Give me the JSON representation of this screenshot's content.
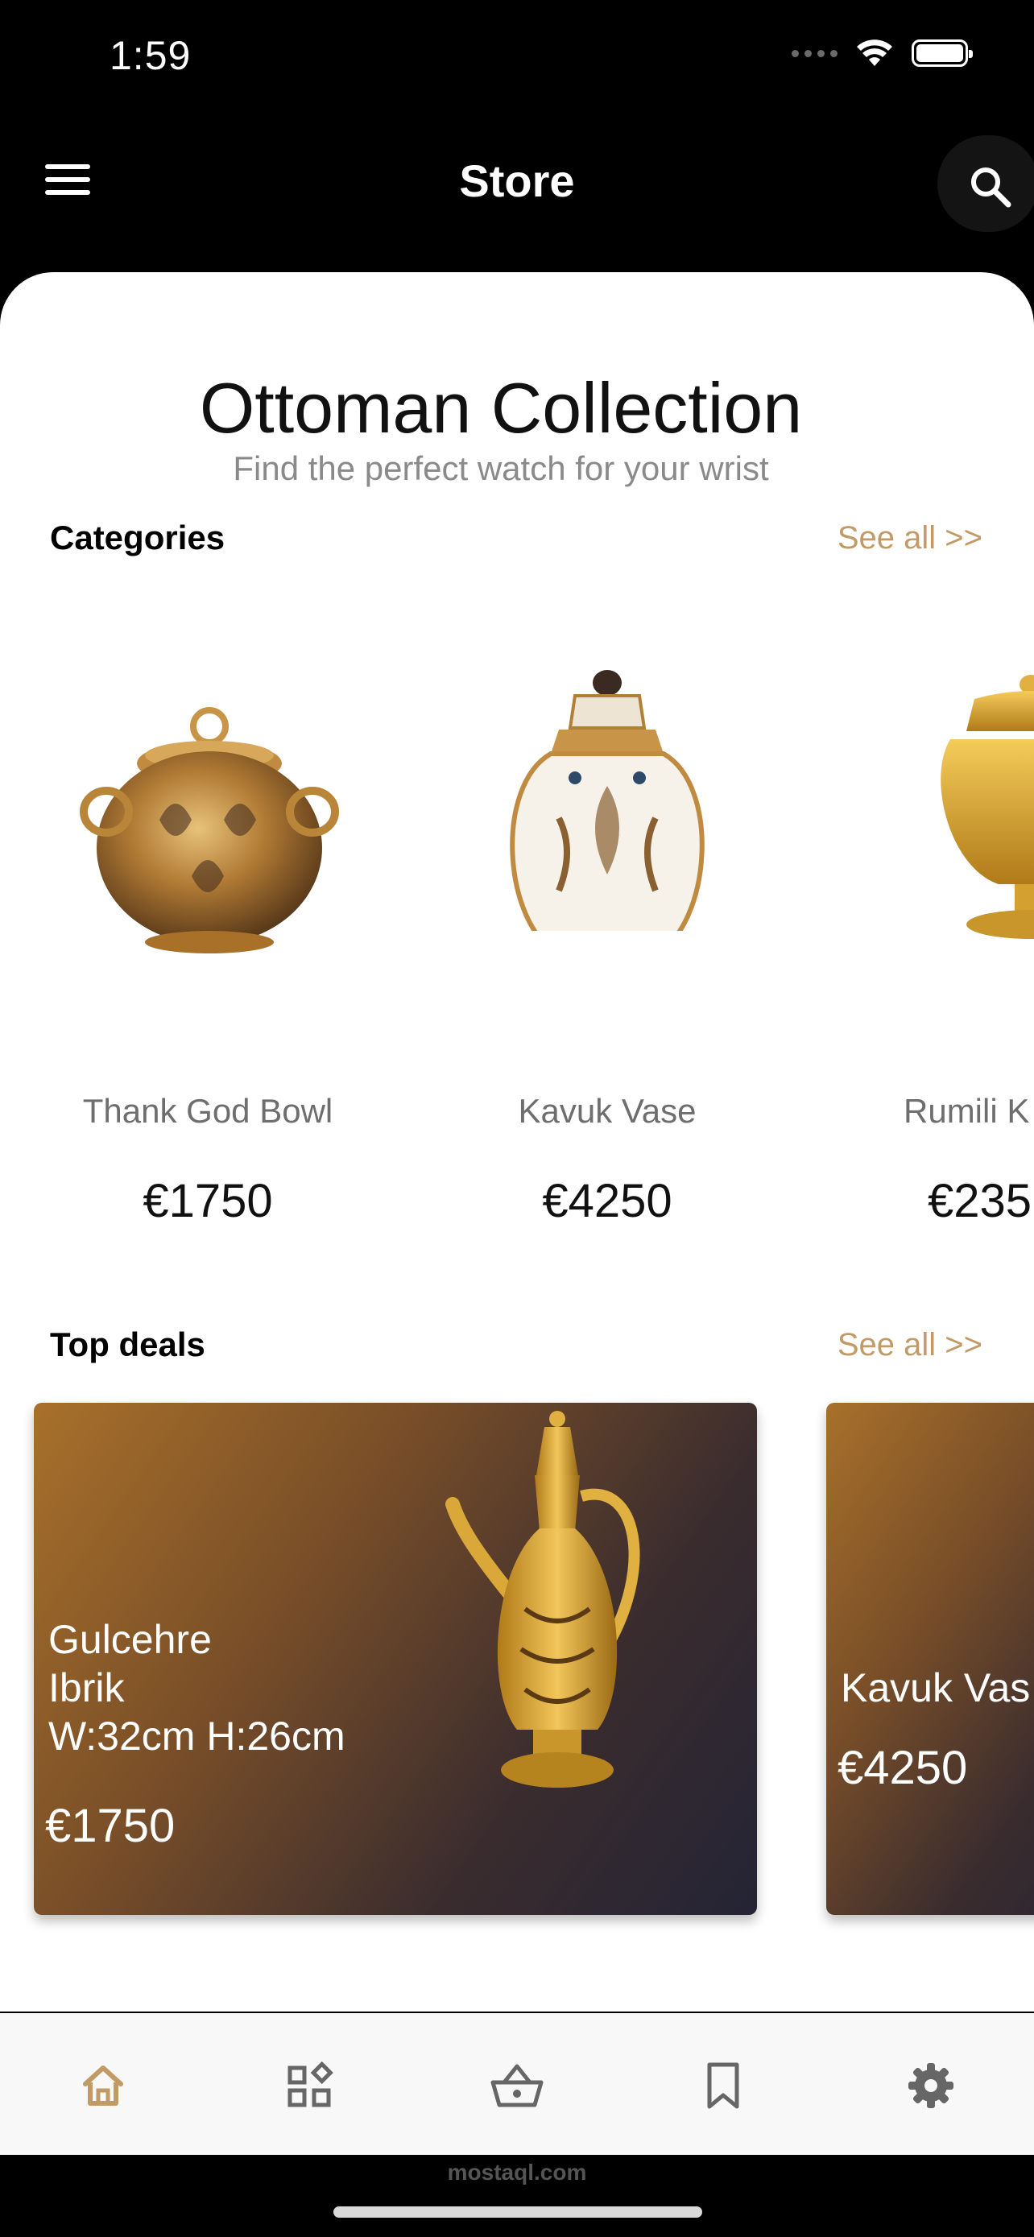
{
  "status_bar": {
    "time": "1:59"
  },
  "header": {
    "title": "Store",
    "menu_icon": "menu-icon",
    "search_icon": "search-icon"
  },
  "collection": {
    "title": "Ottoman Collection",
    "subtitle": "Find the perfect watch for your wrist"
  },
  "categories": {
    "label": "Categories",
    "see_all": "See all >>",
    "items": [
      {
        "name": "Thank God Bowl",
        "price": "€1750"
      },
      {
        "name": "Kavuk Vase",
        "price": "€4250"
      },
      {
        "name": "Rumili K",
        "price": "€235"
      }
    ]
  },
  "top_deals": {
    "label": "Top deals",
    "see_all": "See all >>",
    "items": [
      {
        "title": "Gulcehre\n Ibrik\n W:32cm H:26cm",
        "price": "€1750"
      },
      {
        "title": "Kavuk Vas",
        "price": "€4250"
      }
    ]
  },
  "bottom_nav": {
    "active_color": "#c29a66",
    "inactive_color": "#666666",
    "items": [
      {
        "icon": "home-icon",
        "active": true
      },
      {
        "icon": "categories-icon",
        "active": false
      },
      {
        "icon": "basket-icon",
        "active": false
      },
      {
        "icon": "bookmark-icon",
        "active": false
      },
      {
        "icon": "settings-icon",
        "active": false
      }
    ]
  },
  "watermark": "mostaql.com"
}
